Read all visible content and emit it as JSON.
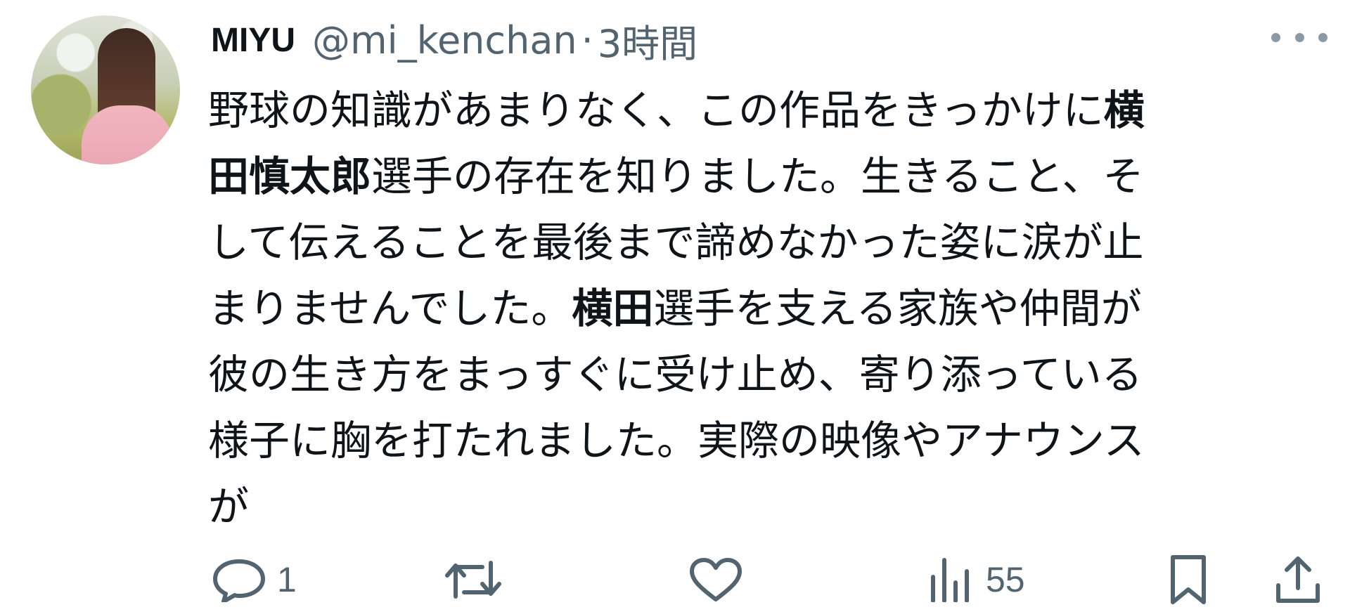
{
  "user": {
    "display_name": "MIYU",
    "handle": "@mi_kenchan",
    "separator": "·",
    "time": "3時間"
  },
  "tweet": {
    "lines": [
      [
        {
          "text": "野球の知識があまりなく、この作品をきっかけに",
          "bold": false
        },
        {
          "text": "横",
          "bold": true
        }
      ],
      [
        {
          "text": "田慎太郎",
          "bold": true
        },
        {
          "text": "選手の存在を知りました。生きること、そ",
          "bold": false
        }
      ],
      [
        {
          "text": "して伝えることを最後まで諦めなかった姿に涙が止",
          "bold": false
        }
      ],
      [
        {
          "text": "まりませんでした。",
          "bold": false
        },
        {
          "text": "横田",
          "bold": true
        },
        {
          "text": "選手を支える家族や仲間が",
          "bold": false
        }
      ],
      [
        {
          "text": "彼の生き方をまっすぐに受け止め、寄り添っている",
          "bold": false
        }
      ],
      [
        {
          "text": "様子に胸を打たれました。実際の映像やアナウンス",
          "bold": false
        }
      ],
      [
        {
          "text": "が",
          "bold": false
        }
      ]
    ]
  },
  "actions": {
    "reply_count": "1",
    "retweet_count": "",
    "like_count": "",
    "views_count": "55"
  },
  "colors": {
    "text": "#0f1419",
    "muted": "#536471"
  },
  "icons": [
    "more-icon",
    "reply-icon",
    "retweet-icon",
    "like-icon",
    "views-icon",
    "bookmark-icon",
    "share-icon"
  ]
}
